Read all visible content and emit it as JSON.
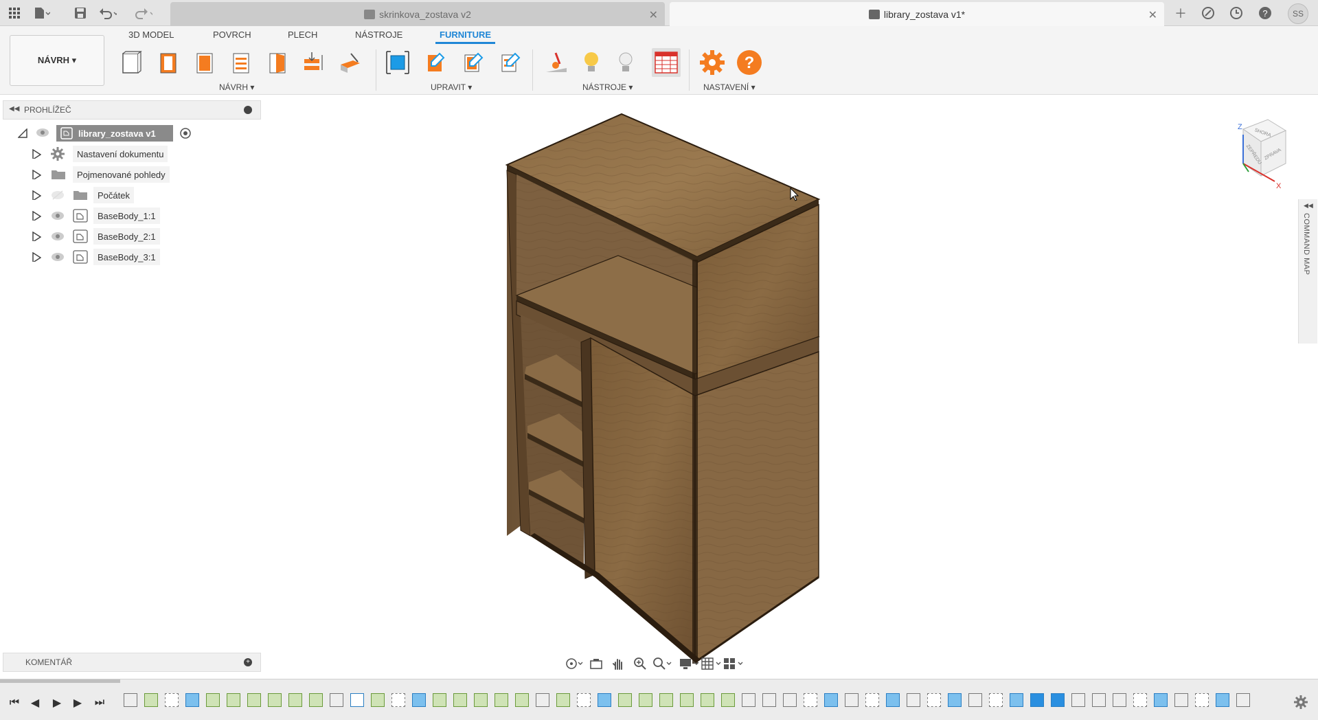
{
  "titlebar": {
    "tabs": [
      {
        "label": "skrinkova_zostava v2",
        "active": false
      },
      {
        "label": "library_zostava v1*",
        "active": true
      }
    ],
    "avatar_initials": "SS"
  },
  "ribbon": {
    "workspace_label": "NÁVRH ▾",
    "tabs": [
      "3D MODEL",
      "POVRCH",
      "PLECH",
      "NÁSTROJE",
      "FURNITURE"
    ],
    "active_tab": "FURNITURE",
    "groups": [
      "NÁVRH ▾",
      "UPRAVIT ▾",
      "NÁSTROJE ▾",
      "NASTAVENÍ ▾"
    ],
    "colors": {
      "accent": "#1f86d6",
      "orange": "#f47c20"
    }
  },
  "browser": {
    "title": "PROHLÍŽEČ",
    "root": "library_zostava v1",
    "items": [
      {
        "label": "Nastavení dokumentu",
        "icon": "gear-icon"
      },
      {
        "label": "Pojmenované pohledy",
        "icon": "folder-icon"
      },
      {
        "label": "Počátek",
        "icon": "folder-icon"
      },
      {
        "label": "BaseBody_1:1",
        "icon": "component-icon"
      },
      {
        "label": "BaseBody_2:1",
        "icon": "component-icon"
      },
      {
        "label": "BaseBody_3:1",
        "icon": "component-icon"
      }
    ]
  },
  "comments": {
    "title": "KOMENTÁŘ"
  },
  "viewcube": {
    "top": "SHORA",
    "front": "ZEPŘEDU",
    "right": "ZPRAVA",
    "axis_z": "Z",
    "axis_x": "X"
  },
  "command_map": {
    "label": "COMMAND MAP"
  }
}
